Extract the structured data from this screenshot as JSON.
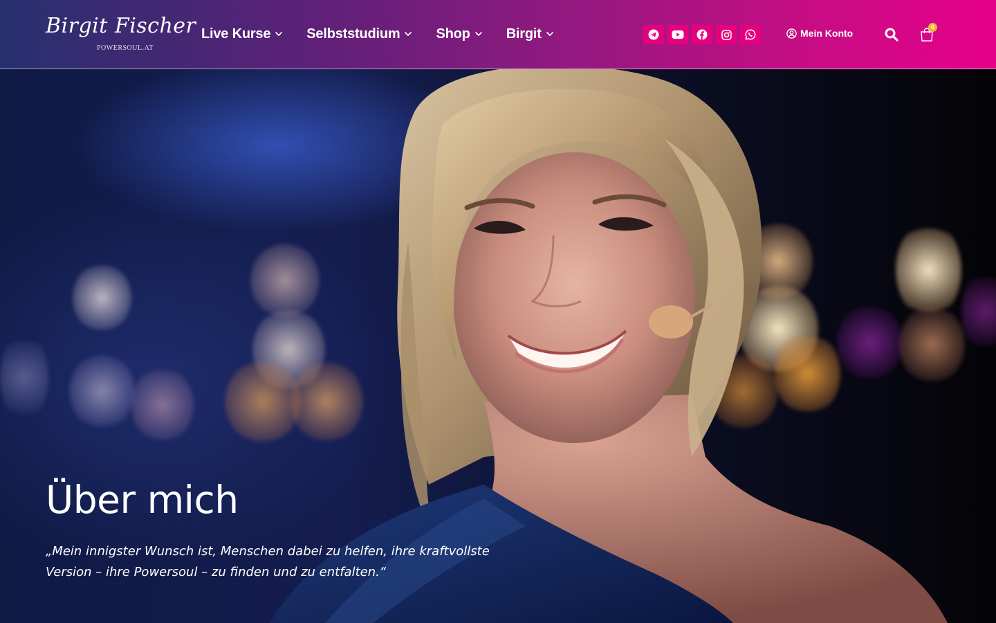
{
  "logo": {
    "script_text": "Birgit Fischer",
    "subtitle": "POWERSOUL.AT"
  },
  "nav": {
    "items": [
      {
        "label": "Live Kurse",
        "icon": "chevron-down-icon"
      },
      {
        "label": "Selbststudium",
        "icon": "chevron-down-icon"
      },
      {
        "label": "Shop",
        "icon": "chevron-down-icon"
      },
      {
        "label": "Birgit",
        "icon": "chevron-down-icon"
      }
    ]
  },
  "socials": [
    {
      "name": "telegram",
      "icon": "telegram-icon"
    },
    {
      "name": "youtube",
      "icon": "youtube-icon"
    },
    {
      "name": "facebook",
      "icon": "facebook-icon"
    },
    {
      "name": "instagram",
      "icon": "instagram-icon"
    },
    {
      "name": "whatsapp",
      "icon": "whatsapp-icon"
    }
  ],
  "account": {
    "label": "Mein Konto",
    "icon": "user-circle-icon"
  },
  "search": {
    "icon": "search-icon"
  },
  "cart": {
    "icon": "shopping-bag-icon",
    "count": "0"
  },
  "hero": {
    "title": "Über mich",
    "quote": "„Mein innigster Wunsch ist, Menschen dabei zu helfen, ihre kraftvollste Version – ihre Powersoul – zu finden und zu entfalten.“"
  },
  "colors": {
    "header_gradient_start": "#27306e",
    "header_gradient_end": "#e6008a",
    "social_bg": "#e6007e",
    "cart_badge": "#f2b233"
  }
}
